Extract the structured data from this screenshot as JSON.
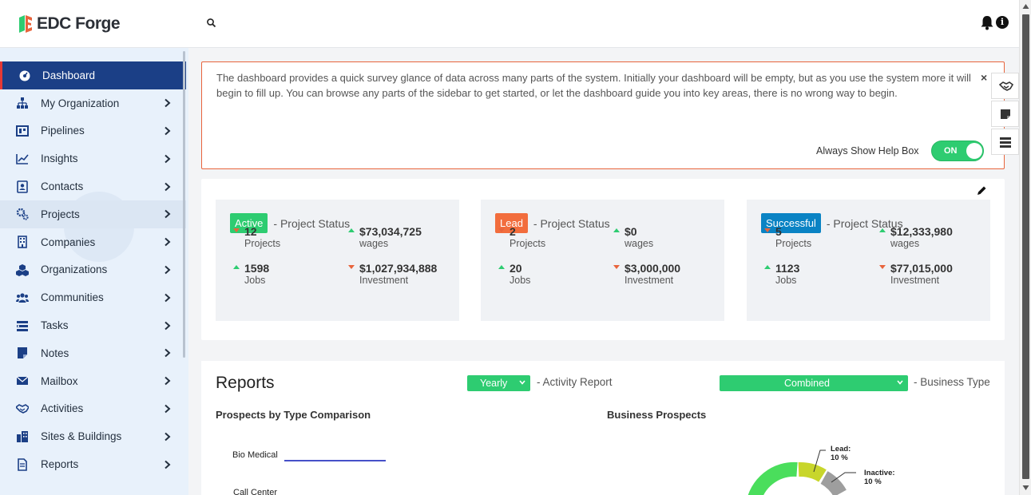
{
  "app": {
    "name": "EDC Forge"
  },
  "header": {
    "search_icon": "search-icon",
    "bell_icon": "bell-icon",
    "info_icon": "info-icon",
    "info_glyph": "i"
  },
  "sidebar": {
    "items": [
      {
        "label": "Dashboard",
        "icon": "dashboard-icon",
        "active": true
      },
      {
        "label": "My Organization",
        "icon": "org-chart-icon"
      },
      {
        "label": "Pipelines",
        "icon": "pipeline-board-icon"
      },
      {
        "label": "Insights",
        "icon": "line-chart-icon"
      },
      {
        "label": "Contacts",
        "icon": "contact-card-icon"
      },
      {
        "label": "Projects",
        "icon": "gears-icon"
      },
      {
        "label": "Companies",
        "icon": "building-icon"
      },
      {
        "label": "Organizations",
        "icon": "cubes-icon"
      },
      {
        "label": "Communities",
        "icon": "users-icon"
      },
      {
        "label": "Tasks",
        "icon": "tasks-icon"
      },
      {
        "label": "Notes",
        "icon": "note-icon"
      },
      {
        "label": "Mailbox",
        "icon": "envelope-icon"
      },
      {
        "label": "Activities",
        "icon": "handshake-icon"
      },
      {
        "label": "Sites & Buildings",
        "icon": "city-icon"
      },
      {
        "label": "Reports",
        "icon": "report-file-icon"
      }
    ]
  },
  "help_box": {
    "text": "The dashboard provides a quick survey glance of data across many parts of the system. Initially your dashboard will be empty, but as you use the system more it will begin to fill up. You can browse any parts of the sidebar to get started, or let the dashboard guide you into key areas, there is no wrong way to begin.",
    "close_glyph": "×",
    "toggle_label": "Always Show Help Box",
    "toggle_value": "ON"
  },
  "status_panels": [
    {
      "badge": "Active",
      "badge_color": "#2ecc71",
      "title": "- Project Status",
      "metrics": [
        {
          "value": "12",
          "label": "Projects",
          "trend": "down"
        },
        {
          "value": "$73,034,725",
          "label": "wages",
          "trend": "up"
        },
        {
          "value": "1598",
          "label": "Jobs",
          "trend": "up"
        },
        {
          "value": "$1,027,934,888",
          "label": "Investment",
          "trend": "down"
        }
      ]
    },
    {
      "badge": "Lead",
      "badge_color": "#f26d3d",
      "title": "- Project Status",
      "metrics": [
        {
          "value": "2",
          "label": "Projects",
          "trend": "down"
        },
        {
          "value": "$0",
          "label": "wages",
          "trend": "up"
        },
        {
          "value": "20",
          "label": "Jobs",
          "trend": "up"
        },
        {
          "value": "$3,000,000",
          "label": "Investment",
          "trend": "down"
        }
      ]
    },
    {
      "badge": "Successful",
      "badge_color": "#0a83c4",
      "title": "- Project Status",
      "metrics": [
        {
          "value": "5",
          "label": "Projects",
          "trend": "down"
        },
        {
          "value": "$12,333,980",
          "label": "wages",
          "trend": "up"
        },
        {
          "value": "1123",
          "label": "Jobs",
          "trend": "up"
        },
        {
          "value": "$77,015,000",
          "label": "Investment",
          "trend": "down"
        }
      ]
    }
  ],
  "reports": {
    "title": "Reports",
    "period_select": "Yearly",
    "period_caption": "- Activity Report",
    "type_select": "Combined",
    "type_caption": "- Business Type",
    "left_chart_title": "Prospects by Type Comparison",
    "right_chart_title": "Business Prospects",
    "bar_labels": [
      "Bio Medical",
      "Call Center"
    ],
    "donut_labels": [
      {
        "name": "Lead:",
        "value": "10 %"
      },
      {
        "name": "Inactive:",
        "value": "10 %"
      }
    ]
  },
  "colors": {
    "accent": "#2ecc71",
    "sidebar_active": "#1b3f86",
    "help_border": "#e8643c",
    "donut_lead": "#c8d62b",
    "donut_inactive": "#9e9e9e",
    "donut_active": "#4ade5c",
    "bar_line": "#4650c8"
  }
}
